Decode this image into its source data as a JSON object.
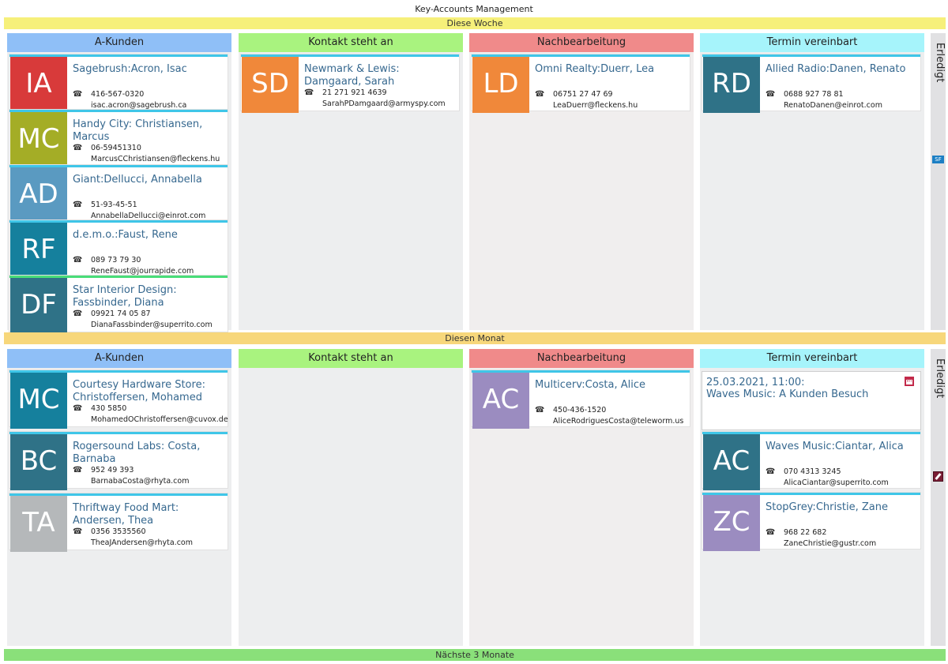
{
  "app": {
    "title": "Key-Accounts Management"
  },
  "sections": {
    "week": "Diese Woche",
    "month": "Diesen Monat",
    "next": "Nächste 3 Monate"
  },
  "columns": {
    "akunden": "A-Kunden",
    "kontakt": "Kontakt steht an",
    "nach": "Nachbearbeitung",
    "termin": "Termin vereinbart"
  },
  "side": {
    "label": "Erledigt",
    "badge": "SF"
  },
  "colors": {
    "blue_teal": "#15809d",
    "red": "#d83a3a",
    "olive": "#a4ad26",
    "steel": "#5a9ac1",
    "dark_teal": "#2f7287",
    "orange": "#f0883a",
    "purple": "#9b8cc0",
    "grey": "#b5b8ba"
  },
  "week_cards": {
    "akunden": [
      {
        "initials": "IA",
        "name": "Sagebrush:Acron, Isac",
        "phone": "416-567-0320",
        "email": "isac.acron@sagebrush.ca"
      },
      {
        "initials": "MC",
        "name": "Handy City: Christiansen, Marcus",
        "phone": "06-59451310",
        "email": "MarcusCChristiansen@fleckens.hu"
      },
      {
        "initials": "AD",
        "name": "Giant:Dellucci, Annabella",
        "phone": "51-93-45-51",
        "email": "AnnabellaDellucci@einrot.com"
      },
      {
        "initials": "RF",
        "name": "d.e.m.o.:Faust, Rene",
        "phone": "089 73 79 30",
        "email": "ReneFaust@jourrapide.com"
      },
      {
        "initials": "DF",
        "name": "Star Interior Design: Fassbinder, Diana",
        "phone": "09921 74 05 87",
        "email": "DianaFassbinder@superrito.com"
      }
    ],
    "kontakt": [
      {
        "initials": "SD",
        "name": "Newmark & Lewis: Damgaard, Sarah",
        "phone": "21 271 921 4639",
        "email": "SarahPDamgaard@armyspy.com"
      }
    ],
    "nach": [
      {
        "initials": "LD",
        "name": "Omni Realty:Duerr, Lea",
        "phone": "06751 27 47 69",
        "email": "LeaDuerr@fleckens.hu"
      }
    ],
    "termin": [
      {
        "initials": "RD",
        "name": "Allied Radio:Danen, Renato",
        "phone": "0688 927 78 81",
        "email": "RenatoDanen@einrot.com"
      }
    ]
  },
  "month_cards": {
    "akunden": [
      {
        "initials": "MC",
        "name": "Courtesy Hardware Store: Christoffersen, Mohamed",
        "phone": "430 5850",
        "email": "MohamedOChristoffersen@cuvox.de"
      },
      {
        "initials": "BC",
        "name": "Rogersound Labs: Costa, Barnaba",
        "phone": "952 49 393",
        "email": "BarnabaCosta@rhyta.com"
      },
      {
        "initials": "TA",
        "name": "Thriftway Food Mart: Andersen, Thea",
        "phone": "0356 3535560",
        "email": "TheaJAndersen@rhyta.com"
      }
    ],
    "nach": [
      {
        "initials": "AC",
        "name": "Multicerv:Costa, Alice",
        "phone": "450-436-1520",
        "email": "AliceRodriguesCosta@teleworm.us"
      }
    ],
    "termin_event": {
      "date": "25.03.2021, 11:00:",
      "title": "Waves Music: A Kunden Besuch"
    },
    "termin": [
      {
        "initials": "AC",
        "name": "Waves Music:Ciantar, Alica",
        "phone": "070 4313 3245",
        "email": "AlicaCiantar@superrito.com"
      },
      {
        "initials": "ZC",
        "name": "StopGrey:Christie, Zane",
        "phone": "968 22 682",
        "email": "ZaneChristie@gustr.com"
      }
    ]
  }
}
